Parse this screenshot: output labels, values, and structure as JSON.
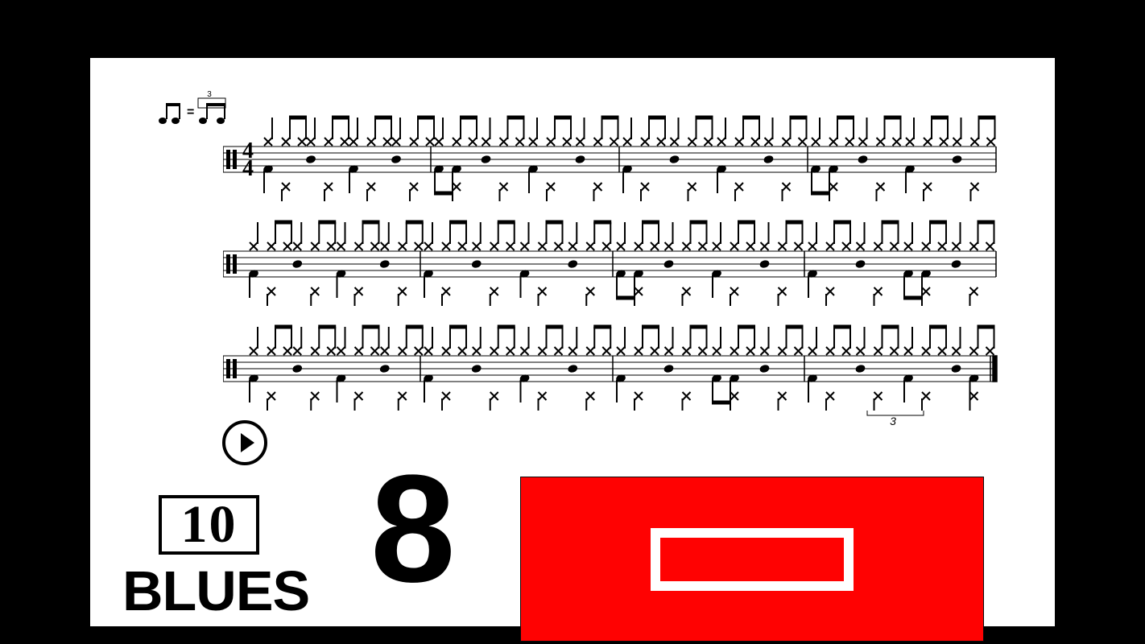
{
  "badge_number": "10",
  "style_label": "BLUES",
  "big_number": "8",
  "time_signature_top": "4",
  "time_signature_bottom": "4",
  "swing_indicator": "shuffle",
  "red_box_color": "#ff0202",
  "staff_rows": 3,
  "bars_per_row": 4,
  "triplet_label": "3"
}
